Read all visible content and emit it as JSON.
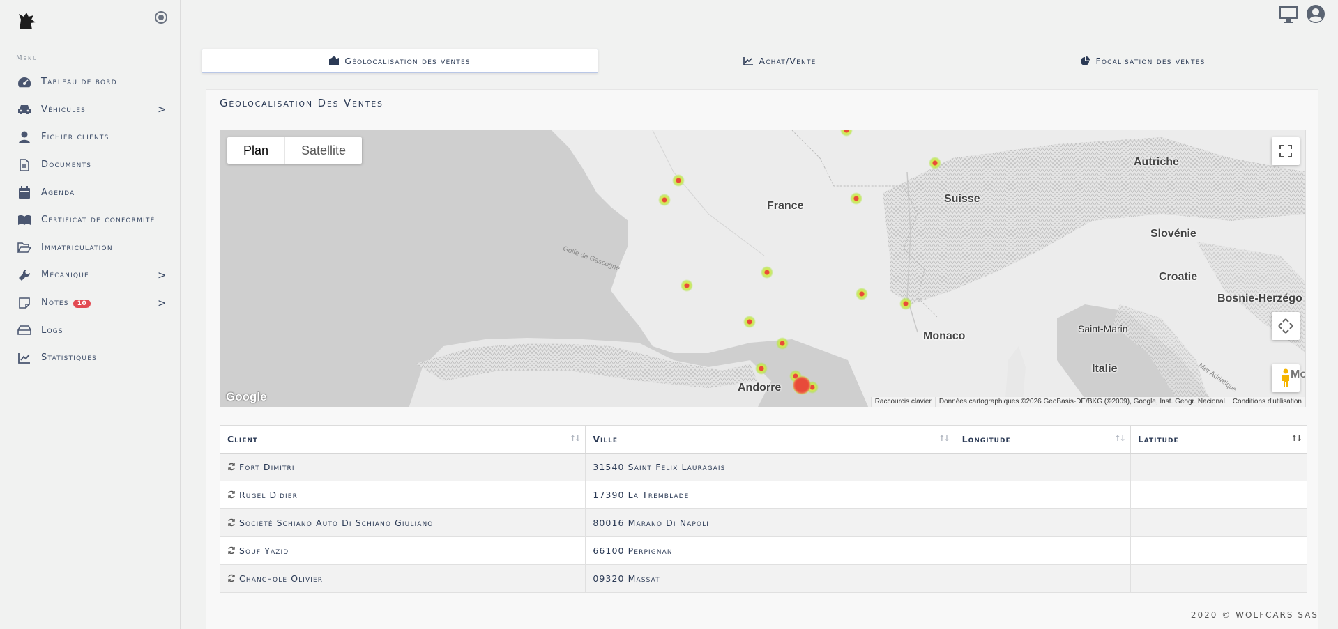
{
  "sidebar": {
    "menu_heading": "Menu",
    "items": [
      {
        "label": "Tableau de bord",
        "icon": "tachometer-icon",
        "arrow": ""
      },
      {
        "label": "Véhicules",
        "icon": "car-icon",
        "arrow": ">"
      },
      {
        "label": "Fichier clients",
        "icon": "user-icon",
        "arrow": ""
      },
      {
        "label": "Documents",
        "icon": "document-icon",
        "arrow": ""
      },
      {
        "label": "Agenda",
        "icon": "calendar-icon",
        "arrow": ""
      },
      {
        "label": "Certificat de conformité",
        "icon": "book-icon",
        "arrow": ""
      },
      {
        "label": "Immatriculation",
        "icon": "folder-open-icon",
        "arrow": ""
      },
      {
        "label": "Mécanique",
        "icon": "wrench-icon",
        "arrow": ">"
      },
      {
        "label": "Notes",
        "icon": "sticky-note-icon",
        "arrow": ">",
        "badge": "10"
      },
      {
        "label": "Logs",
        "icon": "hdd-icon",
        "arrow": ""
      },
      {
        "label": "Statistiques",
        "icon": "line-chart-icon",
        "arrow": ""
      }
    ]
  },
  "tabs": [
    {
      "label": "Géolocalisation des ventes",
      "icon": "map-icon",
      "active": true
    },
    {
      "label": "Achat/Vente",
      "icon": "area-chart-icon",
      "active": false
    },
    {
      "label": "Focalisation des ventes",
      "icon": "pie-chart-icon",
      "active": false
    }
  ],
  "card": {
    "title": "Géolocalisation Des Ventes"
  },
  "map": {
    "type_plan": "Plan",
    "type_satellite": "Satellite",
    "labels": {
      "france": "France",
      "suisse": "Suisse",
      "autriche": "Autriche",
      "slovenie": "Slovénie",
      "croatie": "Croatie",
      "bosnie": "Bosnie-Herzégo",
      "saint_marin": "Saint-Marin",
      "monaco": "Monaco",
      "italie": "Italie",
      "andorre": "Andorre",
      "golfe": "Golfe de Gascogne",
      "mer_adriatique": "Mer Adriatique",
      "mo": "Mo"
    },
    "google": "Google",
    "attribution": [
      "Raccourcis clavier",
      "Données cartographiques ©2026 GeoBasis-DE/BKG (©2009), Google, Inst. Geogr. Nacional",
      "Conditions d'utilisation"
    ]
  },
  "table": {
    "headers": [
      "Client",
      "Ville",
      "Longitude",
      "Latitude"
    ],
    "rows": [
      {
        "client": "Fort Dimitri",
        "ville": "31540 Saint Felix Lauragais",
        "longitude": "",
        "latitude": ""
      },
      {
        "client": "Rugel Didier",
        "ville": "17390 La Tremblade",
        "longitude": "",
        "latitude": ""
      },
      {
        "client": "Société Schiano Auto Di Schiano Giuliano",
        "ville": "80016 Marano Di Napoli",
        "longitude": "",
        "latitude": ""
      },
      {
        "client": "Souf Yazid",
        "ville": "66100 Perpignan",
        "longitude": "",
        "latitude": ""
      },
      {
        "client": "Chanchole Olivier",
        "ville": "09320 Massat",
        "longitude": "",
        "latitude": ""
      }
    ]
  },
  "footer": "2020 © WOLFCARS SAS"
}
